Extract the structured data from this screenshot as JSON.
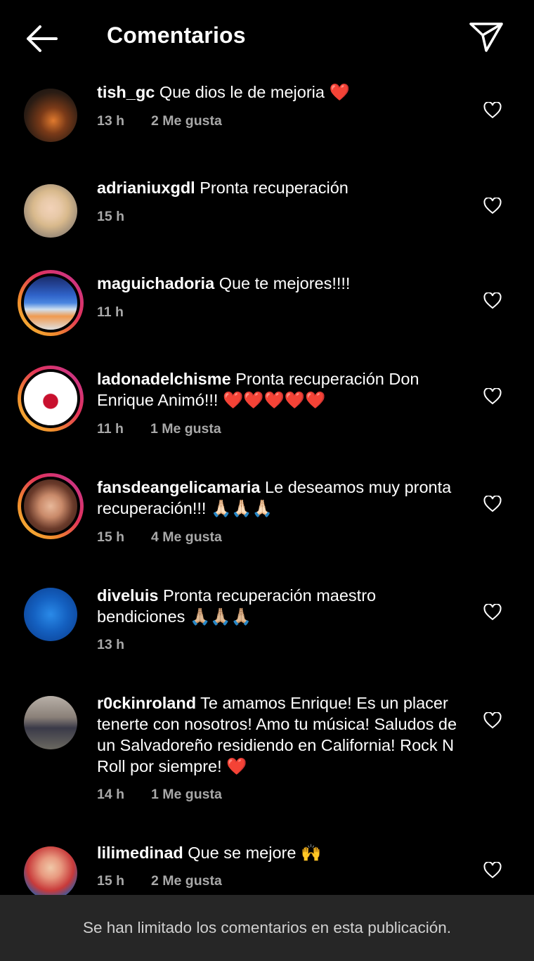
{
  "header": {
    "title": "Comentarios",
    "back_icon": "arrow-left-icon",
    "share_icon": "paper-plane-icon"
  },
  "colors": {
    "background": "#000000",
    "meta": "#a8a8a8",
    "footer_bg": "#262626",
    "heart": "#e8192c"
  },
  "comments": [
    {
      "user": "tish_gc",
      "text": "Que dios le de mejoria",
      "emoji": "❤️",
      "time": "13 h",
      "likes": "2 Me gusta",
      "story_ring": false
    },
    {
      "user": "adrianiuxgdl",
      "text": "Pronta recuperación",
      "emoji": "",
      "time": "15 h",
      "likes": "",
      "story_ring": false
    },
    {
      "user": "maguichadoria",
      "text": "Que te mejores!!!!",
      "emoji": "",
      "time": "11 h",
      "likes": "",
      "story_ring": true
    },
    {
      "user": "ladonadelchisme",
      "text": "Pronta recuperación Don Enrique Animó!!!",
      "emoji": "❤️❤️❤️❤️❤️",
      "time": "11 h",
      "likes": "1 Me gusta",
      "story_ring": true
    },
    {
      "user": "fansdeangelicamaria",
      "text": "Le deseamos muy pronta recuperación!!!",
      "emoji": "🙏🏻🙏🏻🙏🏻",
      "time": "15 h",
      "likes": "4 Me gusta",
      "story_ring": true
    },
    {
      "user": "diveluis",
      "text": "Pronta recuperación maestro bendiciones",
      "emoji": "🙏🏼🙏🏼🙏🏼",
      "time": "13 h",
      "likes": "",
      "story_ring": false
    },
    {
      "user": "r0ckinroland",
      "text": "Te amamos Enrique! Es un placer tenerte con nosotros! Amo tu música! Saludos de un Salvadoreño residiendo en California! Rock N Roll por siempre!",
      "emoji": "❤️",
      "time": "14 h",
      "likes": "1 Me gusta",
      "story_ring": false
    },
    {
      "user": "lilimedinad",
      "text": "Que se mejore",
      "emoji": "🙌",
      "time": "15 h",
      "likes": "2 Me gusta",
      "story_ring": false
    }
  ],
  "footer": {
    "notice": "Se han limitado los comentarios en esta publicación."
  }
}
